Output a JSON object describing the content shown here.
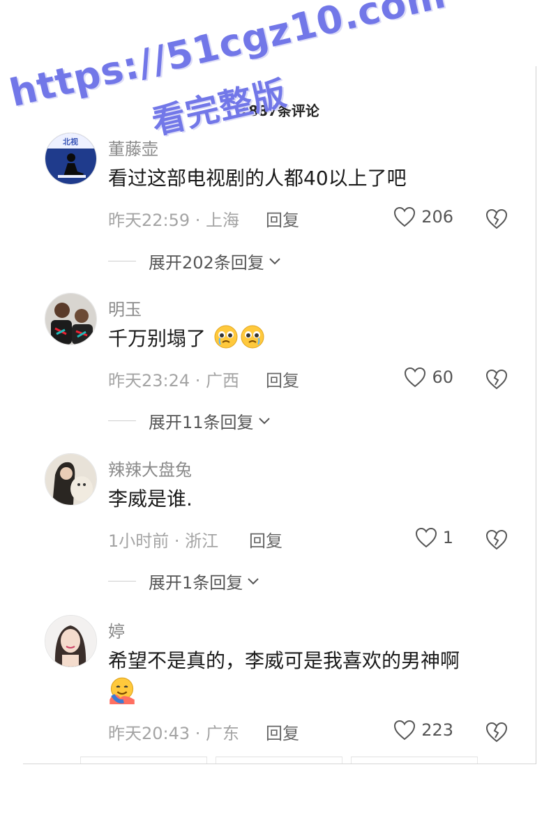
{
  "header": {
    "title": "1887条评论"
  },
  "watermark": {
    "url": "https://51cgz10.com",
    "tagline": "看完整版"
  },
  "comments": [
    {
      "username": "董藤壶",
      "text": "看过这部电视剧的人都40以上了吧",
      "time_location": "昨天22:59 · 上海",
      "reply_label": "回复",
      "likes": "206",
      "expand_label": "展开202条回复",
      "avatar_icon": "figure-silhouette-avatar"
    },
    {
      "username": "明玉",
      "text": "千万别塌了",
      "emoji": "pleading-tears-emoji",
      "time_location": "昨天23:24 · 广西",
      "reply_label": "回复",
      "likes": "60",
      "expand_label": "展开11条回复",
      "avatar_icon": "kids-photo-avatar"
    },
    {
      "username": "辣辣大盘兔",
      "text": "李威是谁.",
      "time_location": "1小时前 · 浙江",
      "reply_label": "回复",
      "likes": "1",
      "expand_label": "展开1条回复",
      "avatar_icon": "woman-with-dog-avatar"
    },
    {
      "username": "婷",
      "text": "希望不是真的，李威可是我喜欢的男神啊",
      "emoji": "hugging-emoji",
      "time_location": "昨天20:43 · 广东",
      "reply_label": "回复",
      "likes": "223",
      "avatar_icon": "woman-portrait-avatar"
    }
  ],
  "icons": {
    "like": "heart-outline-icon",
    "dislike": "broken-heart-icon",
    "expand": "chevron-down-icon"
  },
  "colors": {
    "watermark": "#7277e8",
    "meta": "#a4a4a4",
    "username": "#8a8a8a"
  }
}
